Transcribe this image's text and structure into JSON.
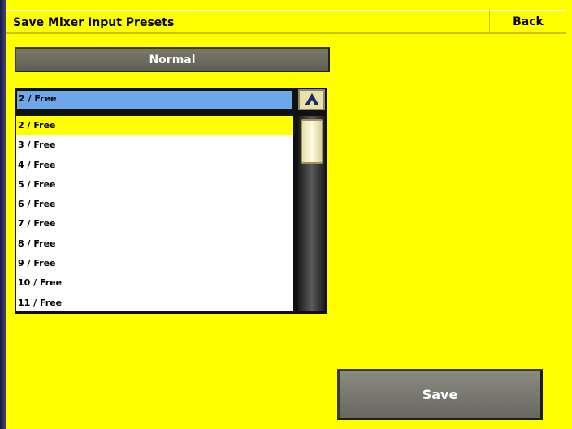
{
  "header": {
    "title": "Save Mixer Input Presets",
    "back_label": "Back"
  },
  "mode": {
    "label": "Normal"
  },
  "preset_list": {
    "selected_value": "2 / Free",
    "items": [
      "2 / Free",
      "3 / Free",
      "4 / Free",
      "5 / Free",
      "6 / Free",
      "7 / Free",
      "8 / Free",
      "9 / Free",
      "10 / Free",
      "11 / Free"
    ],
    "highlighted_index": 0,
    "scroll_up_icon": "chevron-up-icon"
  },
  "actions": {
    "save_label": "Save"
  },
  "colors": {
    "background": "#ffff00",
    "selected_field": "#6ea6ea",
    "button": "#6e6e64"
  }
}
